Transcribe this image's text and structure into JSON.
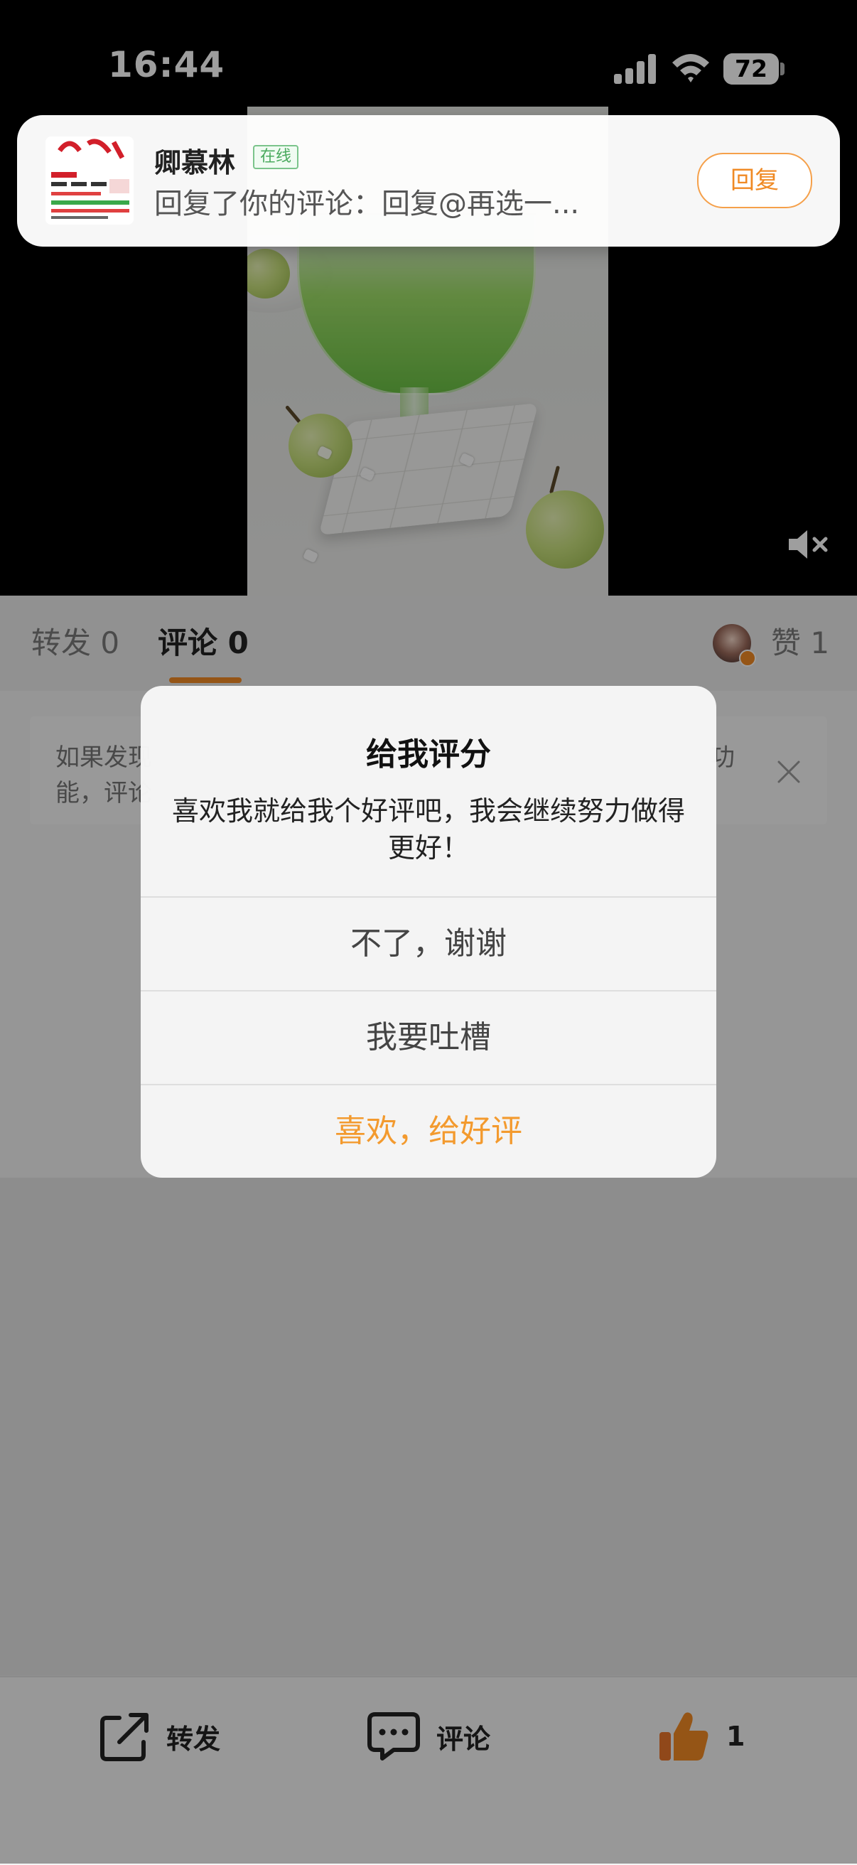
{
  "status_bar": {
    "time": "16:44",
    "battery": "72"
  },
  "notification": {
    "name": "卿慕林",
    "online": "在线",
    "message": "回复了你的评论：回复@再选一...",
    "reply_label": "回复"
  },
  "tabs": {
    "repost": "转发 0",
    "comment": "评论 0",
    "like": "赞 1"
  },
  "tip": {
    "line1": "如果发现",
    "line2": "能，评论",
    "line3": "功"
  },
  "dialog": {
    "title": "给我评分",
    "message": "喜欢我就给我个好评吧，我会继续努力做得更好！",
    "no_label": "不了，谢谢",
    "complain_label": "我要吐槽",
    "good_label": "喜欢，给好评"
  },
  "toolbar": {
    "repost_label": "转发",
    "comment_label": "评论",
    "like_count": "1"
  },
  "colors": {
    "accent": "#f08a24",
    "online": "#4aaa5e"
  }
}
